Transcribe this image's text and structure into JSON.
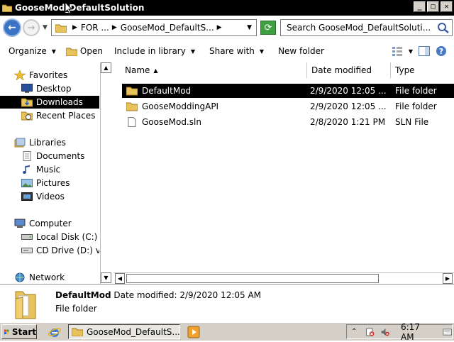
{
  "window": {
    "title": "GooseMod_DefaultSolution",
    "buttons": {
      "minimize": "_",
      "maximize": "□",
      "close": "✕"
    }
  },
  "address": {
    "back_label": "←",
    "forward_label": "→",
    "crumbs": [
      "FOR ...",
      "GooseMod_DefaultS..."
    ],
    "search_placeholder": "Search GooseMod_DefaultSoluti..."
  },
  "toolbar": {
    "organize": "Organize",
    "open": "Open",
    "include_in_library": "Include in library",
    "share_with": "Share with",
    "new_folder": "New folder"
  },
  "nav": {
    "favorites": "Favorites",
    "desktop": "Desktop",
    "downloads": "Downloads",
    "recent_places": "Recent Places",
    "libraries": "Libraries",
    "documents": "Documents",
    "music": "Music",
    "pictures": "Pictures",
    "videos": "Videos",
    "computer": "Computer",
    "local_disk": "Local Disk (C:)",
    "cd_drive": "CD Drive (D:) vi",
    "network": "Network"
  },
  "columns": {
    "name": "Name",
    "date_modified": "Date modified",
    "type": "Type"
  },
  "files": [
    {
      "name": "DefaultMod",
      "date": "2/9/2020 12:05 ...",
      "type": "File folder",
      "kind": "folder"
    },
    {
      "name": "GooseModdingAPI",
      "date": "2/9/2020 12:05 ...",
      "type": "File folder",
      "kind": "folder"
    },
    {
      "name": "GooseMod.sln",
      "date": "2/8/2020 1:21 PM",
      "type": "SLN File",
      "kind": "file"
    }
  ],
  "details": {
    "name": "DefaultMod",
    "date_label": "Date modified:",
    "date_value": "2/9/2020 12:05 AM",
    "type": "File folder"
  },
  "taskbar": {
    "start": "Start",
    "task_title": "GooseMod_DefaultS...",
    "clock": "6:17 AM"
  },
  "colors": {
    "folder": "#e8c25a",
    "selection": "#000000",
    "taskbar": "#d4d0c8"
  }
}
